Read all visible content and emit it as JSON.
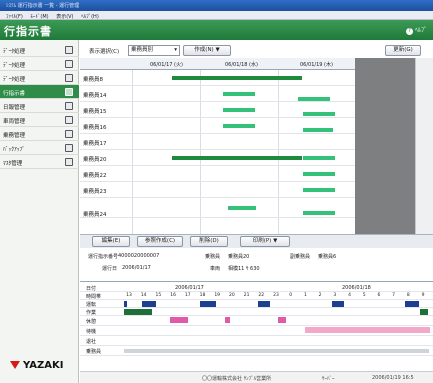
{
  "window": {
    "title": "ｼｽﾃﾑ 運行指示書 一覧 - 運行管理"
  },
  "menu": [
    "ﾌｧｲﾙ(F)",
    "ﾓｰﾄﾞ(M)",
    "表示(V)",
    "ﾍﾙﾌﾟ(H)"
  ],
  "app": {
    "title": "行指示書",
    "help_label": "ﾍﾙﾌﾟ"
  },
  "sidebar": {
    "items": [
      {
        "label": "ﾃﾞｰﾀ処理"
      },
      {
        "label": "ﾃﾞｰﾀ処理"
      },
      {
        "label": "ﾃﾞｰﾀ処理"
      },
      {
        "label": "行指示書"
      },
      {
        "label": "日報管理"
      },
      {
        "label": "車両管理"
      },
      {
        "label": "乗務管理"
      },
      {
        "label": "ﾊﾞｯｸｱｯﾌﾟ"
      },
      {
        "label": "ﾏｽﾀ管理"
      }
    ],
    "logo": "YAZAKI"
  },
  "controls": {
    "display_label": "表示選択(C)",
    "display_value": "乗務員別",
    "create_label": "作成(N)",
    "update_label": "更新(G)"
  },
  "gantt": {
    "dates": [
      "06/01/17 (火)",
      "06/01/18 (水)",
      "06/01/19 (木)"
    ],
    "rows": [
      {
        "label": "乗務員8"
      },
      {
        "label": "乗務員14"
      },
      {
        "label": "乗務員15"
      },
      {
        "label": "乗務員16"
      },
      {
        "label": "乗務員17"
      },
      {
        "label": "乗務員20"
      },
      {
        "label": "乗務員22"
      },
      {
        "label": "乗務員23"
      },
      {
        "label": "乗務員24"
      }
    ]
  },
  "actions": {
    "edit": "編集(E)",
    "ref_create": "参照作成(C)",
    "delete": "削除(D)",
    "print": "印刷(P)"
  },
  "detail": {
    "instruction_no_label": "運行指示番号",
    "instruction_no": "4000020000007",
    "crew_label": "乗務員",
    "crew_value": "乗務員20",
    "sub_crew_label": "副乗務員",
    "sub_crew_value": "乗務員6",
    "date_label": "運行日",
    "date_value": "2006/01/17",
    "vehicle_label": "車両",
    "vehicle_value": "相模11 ｻ 630"
  },
  "timeline": {
    "date_label": "日付",
    "hour_label": "時間帯",
    "date1": "2006/01/17",
    "date2": "2006/01/18",
    "hours": [
      "13",
      "14",
      "15",
      "16",
      "17",
      "18",
      "19",
      "20",
      "21",
      "22",
      "23",
      "0",
      "1",
      "2",
      "3",
      "4",
      "5",
      "6",
      "7",
      "8",
      "9"
    ],
    "rows": [
      "運転",
      "作業",
      "休憩",
      "待機",
      "退社",
      "乗務員"
    ],
    "colors": {
      "drive": "#1c3f8f",
      "work": "#1f6f3a",
      "rest": "#e05aa8",
      "wait": "#f2a9c9"
    }
  },
  "footer": {
    "company": "〇〇運輸株式会社 ｻﾝﾌﾟﾙ営業所",
    "server": "ｻｰﾊﾞｰ",
    "datetime": "2006/01/19 16:5"
  }
}
